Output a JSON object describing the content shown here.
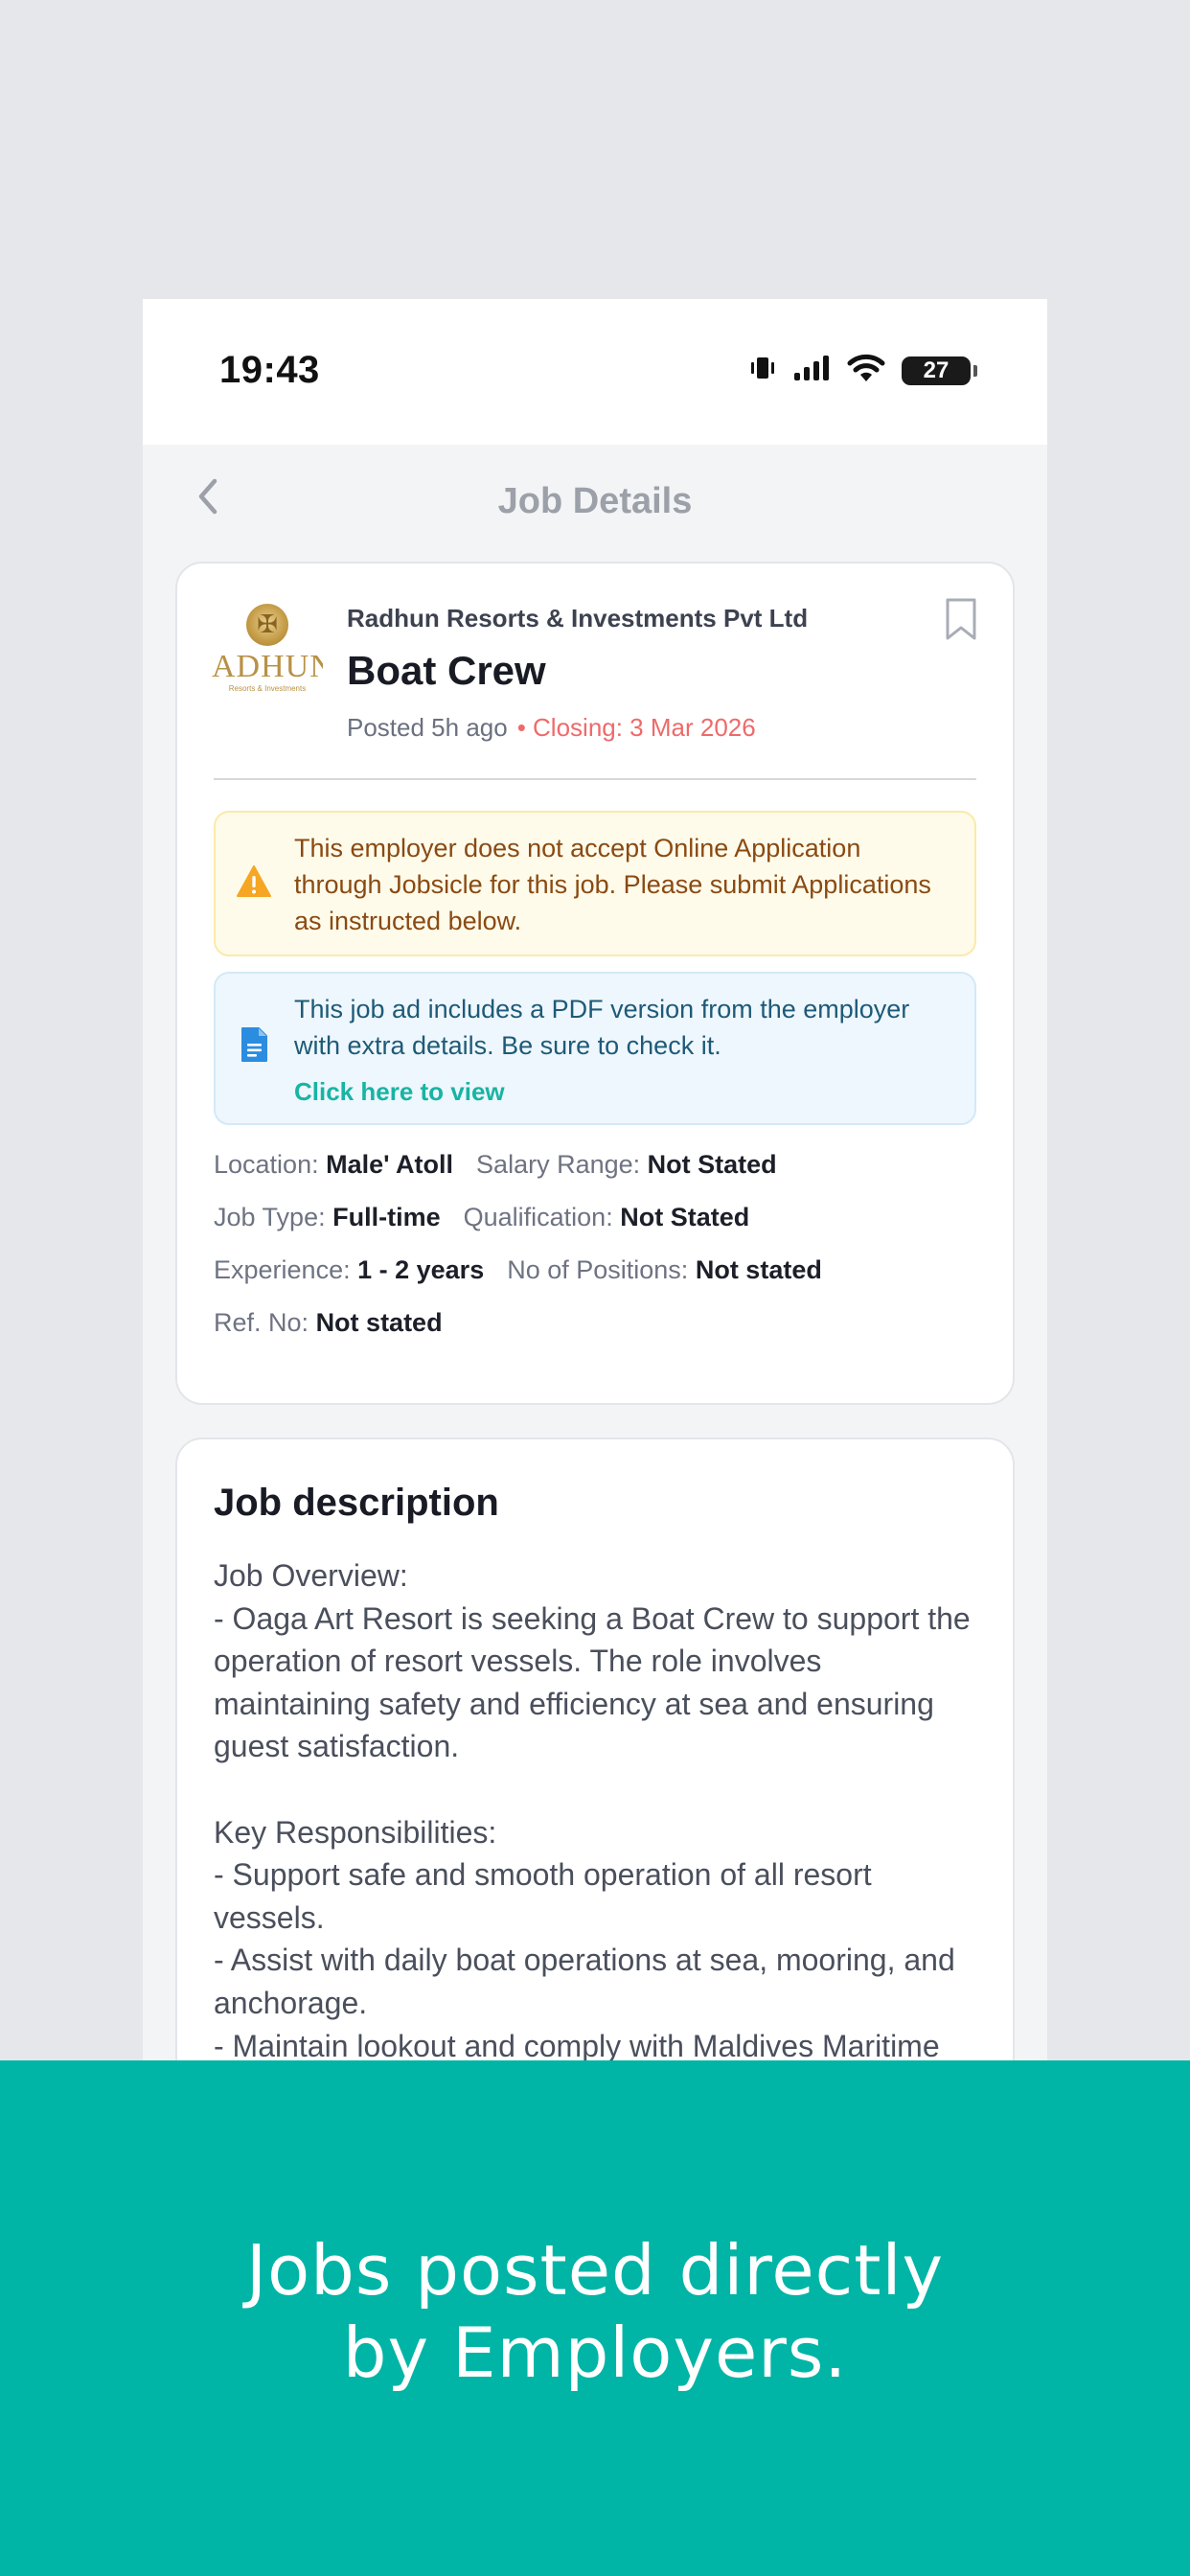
{
  "status_bar": {
    "time": "19:43",
    "battery": "27"
  },
  "header": {
    "title": "Job Details"
  },
  "job": {
    "company": "Radhun Resorts & Investments Pvt Ltd",
    "title": "Boat Crew",
    "posted": "Posted 5h ago",
    "closing": "• Closing: 3 Mar 2026",
    "logo_text": "ADHUN",
    "logo_sub": "Resorts & Investments"
  },
  "alerts": {
    "warning_text": "This employer does not accept Online Application through Jobsicle for this job. Please submit Applications as instructed below.",
    "pdf_text": "This job ad includes a PDF version from the employer with extra details. Be sure to check it.",
    "pdf_link": "Click here to view"
  },
  "details": {
    "location_label": "Location:",
    "location": "Male' Atoll",
    "salary_label": "Salary Range:",
    "salary": "Not Stated",
    "job_type_label": "Job Type:",
    "job_type": "Full-time",
    "qualification_label": "Qualification:",
    "qualification": "Not Stated",
    "experience_label": "Experience:",
    "experience": "1 - 2 years",
    "positions_label": "No of Positions:",
    "positions": "Not stated",
    "ref_label": "Ref. No:",
    "ref": "Not stated"
  },
  "description": {
    "title": "Job description",
    "body": "Job Overview:\n- Oaga Art Resort is seeking a Boat Crew to support the operation of resort vessels. The role involves maintaining safety and efficiency at sea and ensuring guest satisfaction.\n\nKey Responsibilities:\n- Support safe and smooth operation of all resort vessels.\n- Assist with daily boat operations at sea, mooring, and anchorage.\n- Maintain lookout and comply with Maldives Maritime"
  },
  "banner": {
    "line1": "Jobs posted directly",
    "line2": "by Employers."
  },
  "colors": {
    "accent": "#00b5a6",
    "closing": "#ee6a6a",
    "link": "#18b4a4"
  }
}
